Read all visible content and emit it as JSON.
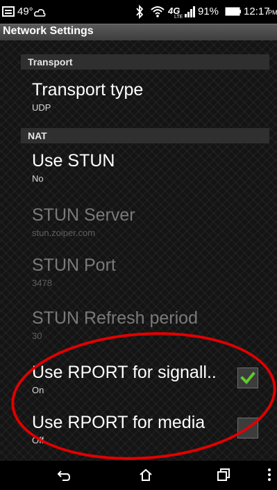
{
  "status_bar": {
    "temperature": "49°",
    "signal": "91%",
    "time": "12:17",
    "time_suffix": "PM",
    "icons": [
      "image-icon",
      "weather-icon",
      "bluetooth-icon",
      "wifi-icon",
      "4g-lte-icon",
      "signal-bars-icon",
      "battery-icon"
    ]
  },
  "header": {
    "title": "Network Settings"
  },
  "sections": [
    {
      "header": "Transport"
    },
    {
      "header": "NAT"
    }
  ],
  "settings": {
    "transport_type": {
      "title": "Transport type",
      "summary": "UDP",
      "enabled": true
    },
    "use_stun": {
      "title": "Use STUN",
      "summary": "No",
      "enabled": true
    },
    "stun_server": {
      "title": "STUN Server",
      "summary": "stun.zoiper.com",
      "enabled": false
    },
    "stun_port": {
      "title": "STUN Port",
      "summary": "3478",
      "enabled": false
    },
    "stun_refresh": {
      "title": "STUN Refresh period",
      "summary": "30",
      "enabled": false
    },
    "rport_signalling": {
      "title": "Use RPORT for signall..",
      "summary": "On",
      "checked": true
    },
    "rport_media": {
      "title": "Use RPORT for media",
      "summary": "Off",
      "checked": false
    }
  },
  "annotation": {
    "color": "#e10000"
  },
  "nav": {
    "icons": [
      "back-icon",
      "home-icon",
      "recent-apps-icon",
      "overflow-menu-icon"
    ]
  },
  "colors": {
    "accent": "#5fcc2a",
    "header_bg": "#2f2f2f"
  }
}
